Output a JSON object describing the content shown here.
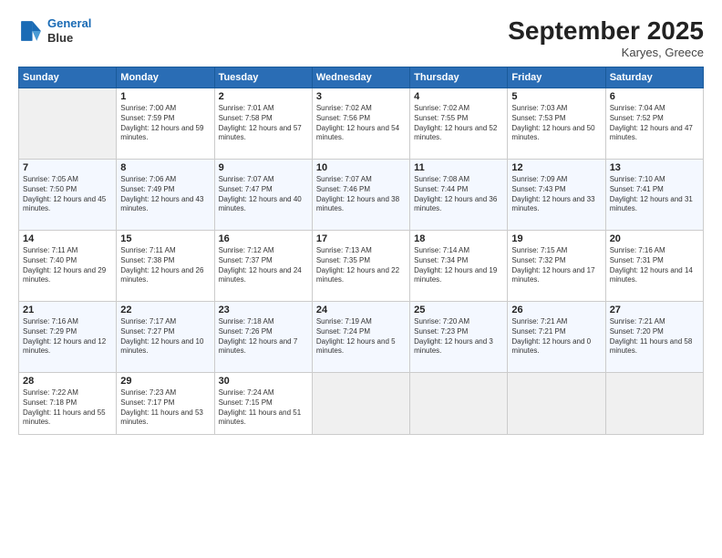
{
  "header": {
    "logo_line1": "General",
    "logo_line2": "Blue",
    "month": "September 2025",
    "location": "Karyes, Greece"
  },
  "days_of_week": [
    "Sunday",
    "Monday",
    "Tuesday",
    "Wednesday",
    "Thursday",
    "Friday",
    "Saturday"
  ],
  "weeks": [
    [
      {
        "num": "",
        "empty": true
      },
      {
        "num": "1",
        "sunrise": "7:00 AM",
        "sunset": "7:59 PM",
        "daylight": "12 hours and 59 minutes."
      },
      {
        "num": "2",
        "sunrise": "7:01 AM",
        "sunset": "7:58 PM",
        "daylight": "12 hours and 57 minutes."
      },
      {
        "num": "3",
        "sunrise": "7:02 AM",
        "sunset": "7:56 PM",
        "daylight": "12 hours and 54 minutes."
      },
      {
        "num": "4",
        "sunrise": "7:02 AM",
        "sunset": "7:55 PM",
        "daylight": "12 hours and 52 minutes."
      },
      {
        "num": "5",
        "sunrise": "7:03 AM",
        "sunset": "7:53 PM",
        "daylight": "12 hours and 50 minutes."
      },
      {
        "num": "6",
        "sunrise": "7:04 AM",
        "sunset": "7:52 PM",
        "daylight": "12 hours and 47 minutes."
      }
    ],
    [
      {
        "num": "7",
        "sunrise": "7:05 AM",
        "sunset": "7:50 PM",
        "daylight": "12 hours and 45 minutes."
      },
      {
        "num": "8",
        "sunrise": "7:06 AM",
        "sunset": "7:49 PM",
        "daylight": "12 hours and 43 minutes."
      },
      {
        "num": "9",
        "sunrise": "7:07 AM",
        "sunset": "7:47 PM",
        "daylight": "12 hours and 40 minutes."
      },
      {
        "num": "10",
        "sunrise": "7:07 AM",
        "sunset": "7:46 PM",
        "daylight": "12 hours and 38 minutes."
      },
      {
        "num": "11",
        "sunrise": "7:08 AM",
        "sunset": "7:44 PM",
        "daylight": "12 hours and 36 minutes."
      },
      {
        "num": "12",
        "sunrise": "7:09 AM",
        "sunset": "7:43 PM",
        "daylight": "12 hours and 33 minutes."
      },
      {
        "num": "13",
        "sunrise": "7:10 AM",
        "sunset": "7:41 PM",
        "daylight": "12 hours and 31 minutes."
      }
    ],
    [
      {
        "num": "14",
        "sunrise": "7:11 AM",
        "sunset": "7:40 PM",
        "daylight": "12 hours and 29 minutes."
      },
      {
        "num": "15",
        "sunrise": "7:11 AM",
        "sunset": "7:38 PM",
        "daylight": "12 hours and 26 minutes."
      },
      {
        "num": "16",
        "sunrise": "7:12 AM",
        "sunset": "7:37 PM",
        "daylight": "12 hours and 24 minutes."
      },
      {
        "num": "17",
        "sunrise": "7:13 AM",
        "sunset": "7:35 PM",
        "daylight": "12 hours and 22 minutes."
      },
      {
        "num": "18",
        "sunrise": "7:14 AM",
        "sunset": "7:34 PM",
        "daylight": "12 hours and 19 minutes."
      },
      {
        "num": "19",
        "sunrise": "7:15 AM",
        "sunset": "7:32 PM",
        "daylight": "12 hours and 17 minutes."
      },
      {
        "num": "20",
        "sunrise": "7:16 AM",
        "sunset": "7:31 PM",
        "daylight": "12 hours and 14 minutes."
      }
    ],
    [
      {
        "num": "21",
        "sunrise": "7:16 AM",
        "sunset": "7:29 PM",
        "daylight": "12 hours and 12 minutes."
      },
      {
        "num": "22",
        "sunrise": "7:17 AM",
        "sunset": "7:27 PM",
        "daylight": "12 hours and 10 minutes."
      },
      {
        "num": "23",
        "sunrise": "7:18 AM",
        "sunset": "7:26 PM",
        "daylight": "12 hours and 7 minutes."
      },
      {
        "num": "24",
        "sunrise": "7:19 AM",
        "sunset": "7:24 PM",
        "daylight": "12 hours and 5 minutes."
      },
      {
        "num": "25",
        "sunrise": "7:20 AM",
        "sunset": "7:23 PM",
        "daylight": "12 hours and 3 minutes."
      },
      {
        "num": "26",
        "sunrise": "7:21 AM",
        "sunset": "7:21 PM",
        "daylight": "12 hours and 0 minutes."
      },
      {
        "num": "27",
        "sunrise": "7:21 AM",
        "sunset": "7:20 PM",
        "daylight": "11 hours and 58 minutes."
      }
    ],
    [
      {
        "num": "28",
        "sunrise": "7:22 AM",
        "sunset": "7:18 PM",
        "daylight": "11 hours and 55 minutes."
      },
      {
        "num": "29",
        "sunrise": "7:23 AM",
        "sunset": "7:17 PM",
        "daylight": "11 hours and 53 minutes."
      },
      {
        "num": "30",
        "sunrise": "7:24 AM",
        "sunset": "7:15 PM",
        "daylight": "11 hours and 51 minutes."
      },
      {
        "num": "",
        "empty": true
      },
      {
        "num": "",
        "empty": true
      },
      {
        "num": "",
        "empty": true
      },
      {
        "num": "",
        "empty": true
      }
    ]
  ]
}
